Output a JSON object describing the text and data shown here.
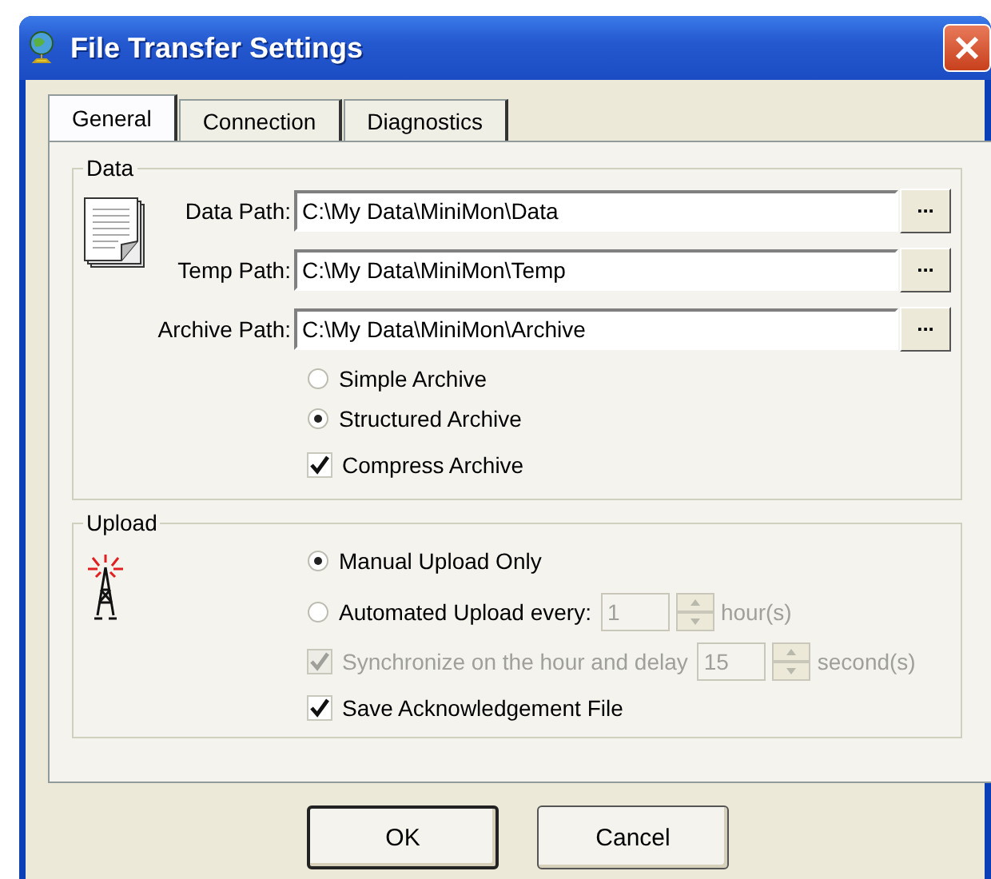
{
  "window": {
    "title": "File Transfer Settings"
  },
  "tabs": [
    {
      "label": "General",
      "selected": true
    },
    {
      "label": "Connection",
      "selected": false
    },
    {
      "label": "Diagnostics",
      "selected": false
    }
  ],
  "data_group": {
    "title": "Data",
    "paths": [
      {
        "label": "Data Path:",
        "value": "C:\\My Data\\MiniMon\\Data",
        "browse": "..."
      },
      {
        "label": "Temp Path:",
        "value": "C:\\My Data\\MiniMon\\Temp",
        "browse": "..."
      },
      {
        "label": "Archive Path:",
        "value": "C:\\My Data\\MiniMon\\Archive",
        "browse": "..."
      }
    ],
    "archive_modes": [
      {
        "label": "Simple Archive",
        "selected": false
      },
      {
        "label": "Structured Archive",
        "selected": true
      }
    ],
    "compress": {
      "label": "Compress Archive",
      "checked": true,
      "disabled": false
    }
  },
  "upload_group": {
    "title": "Upload",
    "modes": [
      {
        "label": "Manual Upload Only",
        "selected": true
      },
      {
        "label": "Automated Upload every:",
        "selected": false,
        "spinner": {
          "value": "1",
          "unit": "hour(s)",
          "disabled": true
        }
      }
    ],
    "synchronize": {
      "label": "Synchronize on the hour and delay",
      "checked": true,
      "disabled": true,
      "spinner": {
        "value": "15",
        "unit": "second(s)",
        "disabled": true
      }
    },
    "save_ack": {
      "label": "Save Acknowledgement File",
      "checked": true,
      "disabled": false
    }
  },
  "buttons": [
    {
      "label": "OK",
      "default": true
    },
    {
      "label": "Cancel",
      "default": false
    }
  ]
}
